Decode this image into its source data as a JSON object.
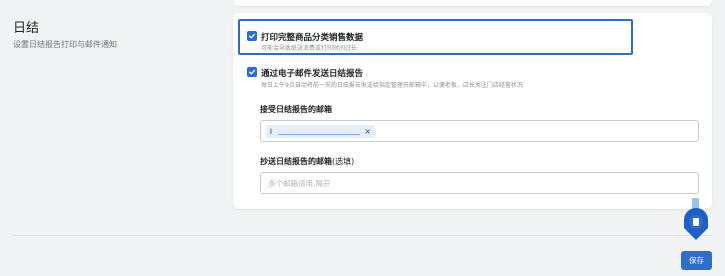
{
  "section": {
    "title": "日结",
    "description": "设置日结报告打印与邮件通知"
  },
  "options": {
    "print": {
      "label": "打印完整商品分类销售数据",
      "help": "可能会导致纸张浪费或打印时间过长",
      "checked": true
    },
    "email": {
      "label": "通过电子邮件发送日结报告",
      "help": "每日上午9点自动将前一天的日结报告发送给指定管理员邮箱中，以便老板、店长关注门店经营状况",
      "checked": true
    }
  },
  "receive_email": {
    "label": "接受日结报告的邮箱",
    "tag_text": "l",
    "tag_remove": "×"
  },
  "cc_email": {
    "label": "抄送日结报告的邮箱",
    "optional": "(选填)",
    "placeholder": "多个邮箱请用,隔开"
  },
  "footer": {
    "save_label": "保存"
  },
  "colors": {
    "accent": "#2c6ecb",
    "background": "#f1f2f4"
  }
}
